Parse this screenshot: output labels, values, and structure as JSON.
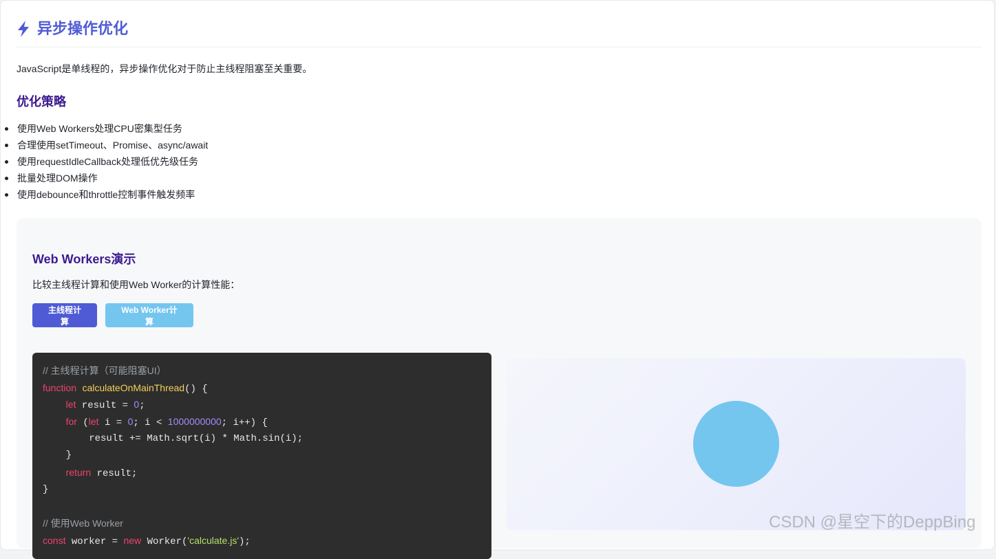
{
  "header": {
    "icon": "lightning-bolt-icon",
    "title": "异步操作优化"
  },
  "intro": "JavaScript是单线程的，异步操作优化对于防止主线程阻塞至关重要。",
  "strategy": {
    "heading": "优化策略",
    "items": [
      "使用Web Workers处理CPU密集型任务",
      "合理使用setTimeout、Promise、async/await",
      "使用requestIdleCallback处理低优先级任务",
      "批量处理DOM操作",
      "使用debounce和throttle控制事件触发频率"
    ]
  },
  "demo": {
    "title": "Web Workers演示",
    "description": "比较主线程计算和使用Web Worker的计算性能：",
    "buttons": {
      "main_thread": "主线程计算",
      "web_worker": "Web Worker计算"
    },
    "code": {
      "line1_comment": "// 主线程计算（可能阻塞UI）",
      "line2_kw": "function",
      "line2_fn": "calculateOnMainThread",
      "line2_rest": "() {",
      "line3_kw": "let",
      "line3_rest": " result = ",
      "line3_num": "0",
      "line3_end": ";",
      "line4_kw": "for",
      "line4_p1": " (",
      "line4_kw2": "let",
      "line4_p2": " i = ",
      "line4_num1": "0",
      "line4_p3": "; i < ",
      "line4_num2": "1000000000",
      "line4_p4": "; i++) {",
      "line5": "result += Math.sqrt(i) * Math.sin(i);",
      "line6": "}",
      "line7_kw": "return",
      "line7_rest": " result;",
      "line8": "}",
      "line10_comment": "// 使用Web Worker",
      "line11_kw": "const",
      "line11_p1": " worker = ",
      "line11_kw2": "new",
      "line11_p2": " Worker(",
      "line11_str": "'calculate.js'",
      "line11_p3": ");"
    }
  },
  "colors": {
    "accent": "#4f5bd5",
    "heading": "#3d1a8f",
    "worker_button": "#74c6ef",
    "code_bg": "#2d2d2d"
  },
  "watermark": "CSDN @星空下的DeppBing"
}
